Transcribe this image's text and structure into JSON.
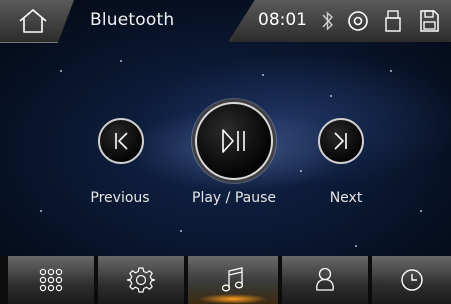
{
  "header": {
    "title": "Bluetooth",
    "time": "08:01",
    "home_icon": "home-icon",
    "status_icons": [
      "bluetooth-icon",
      "disc-icon",
      "usb-icon",
      "sd-card-icon"
    ]
  },
  "controls": {
    "previous": {
      "label": "Previous",
      "icon": "skip-previous-icon"
    },
    "play_pause": {
      "label": "Play / Pause",
      "icon": "play-pause-icon"
    },
    "next": {
      "label": "Next",
      "icon": "skip-next-icon"
    }
  },
  "nav": {
    "items": [
      {
        "icon": "apps-grid-icon",
        "active": false
      },
      {
        "icon": "settings-gear-icon",
        "active": false
      },
      {
        "icon": "music-note-icon",
        "active": true
      },
      {
        "icon": "user-icon",
        "active": false
      },
      {
        "icon": "clock-icon",
        "active": false
      }
    ]
  },
  "colors": {
    "accent": "#ff9d1f",
    "background": "#0a1730"
  }
}
